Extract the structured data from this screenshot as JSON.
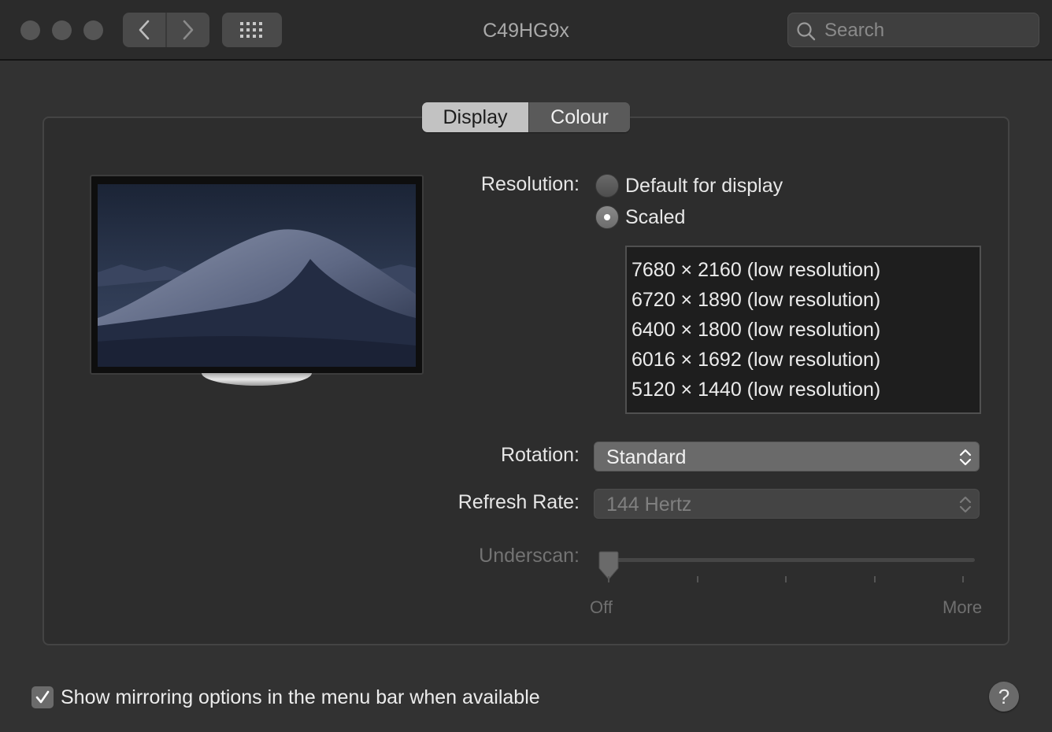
{
  "window": {
    "title": "C49HG9x"
  },
  "toolbar": {
    "back_icon": "chevron-left-icon",
    "forward_icon": "chevron-right-icon",
    "show_all_icon": "grid-icon",
    "search_placeholder": "Search"
  },
  "tabs": [
    {
      "label": "Display",
      "selected": true
    },
    {
      "label": "Colour",
      "selected": false
    }
  ],
  "resolution": {
    "label": "Resolution:",
    "options": [
      {
        "label": "Default for display",
        "selected": false
      },
      {
        "label": "Scaled",
        "selected": true
      }
    ],
    "list": [
      "7680 × 2160 (low resolution)",
      "6720 × 1890 (low resolution)",
      "6400 × 1800 (low resolution)",
      "6016 × 1692 (low resolution)",
      "5120 × 1440 (low resolution)"
    ]
  },
  "rotation": {
    "label": "Rotation:",
    "value": "Standard"
  },
  "refresh_rate": {
    "label": "Refresh Rate:",
    "value": "144 Hertz",
    "enabled": false
  },
  "underscan": {
    "label": "Underscan:",
    "min_label": "Off",
    "max_label": "More",
    "value": 0,
    "enabled": false
  },
  "mirroring": {
    "label": "Show mirroring options in the menu bar when available",
    "checked": true
  },
  "help": {
    "label": "?"
  },
  "colors": {
    "window_bg": "#323232",
    "panel_bg": "#2d2d2d",
    "selected_tab": "#c2c2c2",
    "text": "#e6e6e6",
    "disabled_text": "#737373"
  }
}
